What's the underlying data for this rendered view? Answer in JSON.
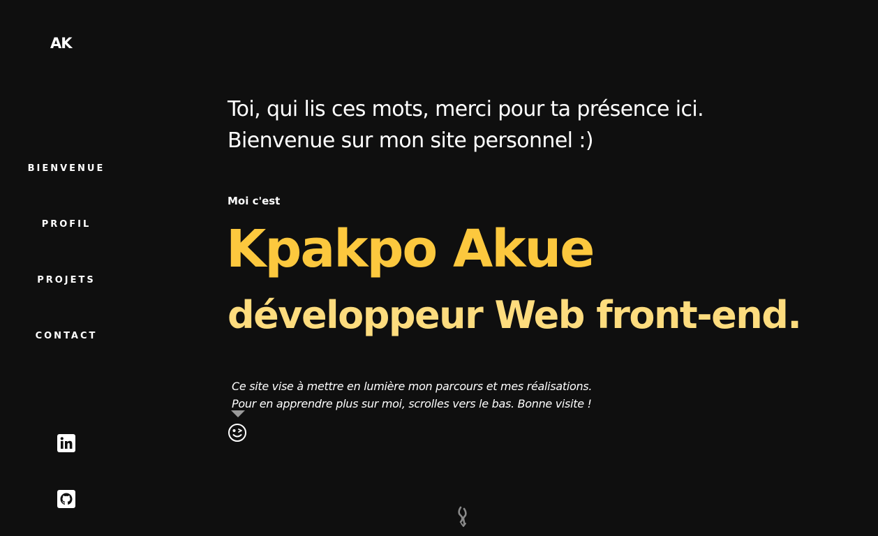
{
  "sidebar": {
    "logo": "AK",
    "nav": [
      {
        "label": "BIENVENUE"
      },
      {
        "label": "PROFIL"
      },
      {
        "label": "PROJETS"
      },
      {
        "label": "CONTACT"
      }
    ],
    "social": [
      {
        "icon": "linkedin-icon"
      },
      {
        "icon": "github-icon"
      }
    ]
  },
  "main": {
    "intro_line1": "Toi, qui lis ces mots, merci pour ta présence ici.",
    "intro_line2": "Bienvenue sur mon site personnel :)",
    "moi_label": "Moi c'est",
    "name": "Kpakpo Akue",
    "role": "développeur Web front-end.",
    "desc_line1": "Ce site vise à mettre en lumière mon parcours et mes réalisations.",
    "desc_line2": "Pour en apprendre plus sur moi, scrolles vers le bas. Bonne visite !",
    "wink_icon": "wink-emoji-icon",
    "scroll_icon": "scroll-down-icon"
  },
  "colors": {
    "background": "#0f0f0f",
    "name": "#fcc83e",
    "role": "#fddc7e",
    "text": "#ffffff"
  }
}
